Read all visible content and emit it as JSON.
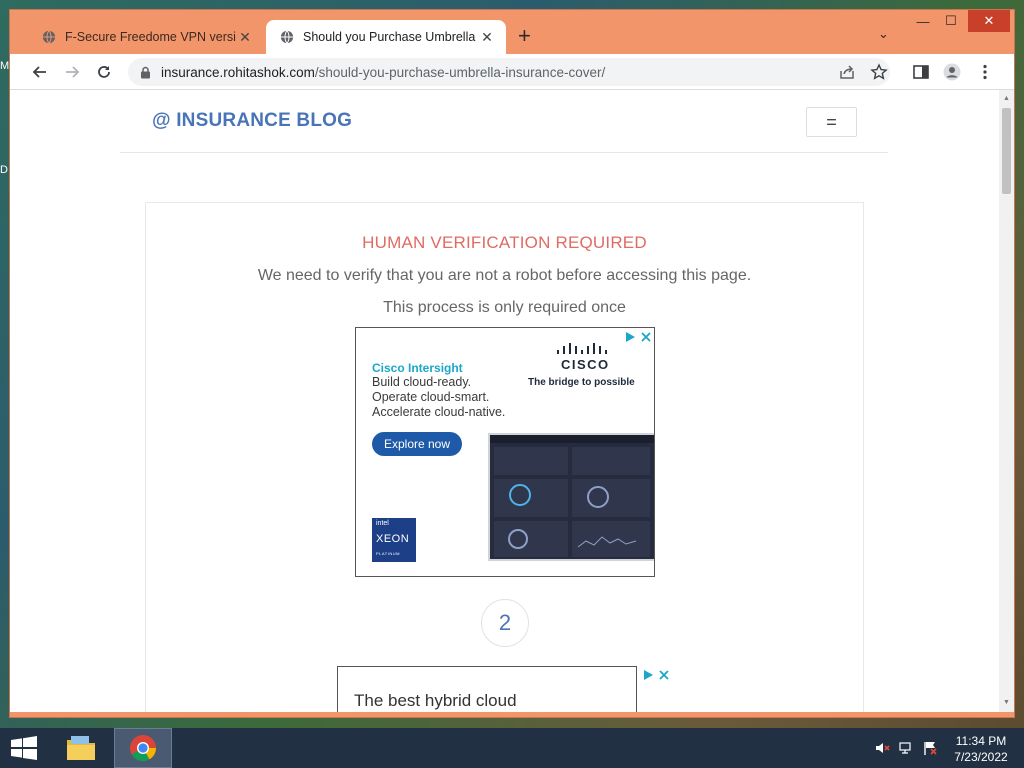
{
  "desktop": {
    "edge_chars": [
      "M",
      "D"
    ]
  },
  "browser": {
    "tabs": [
      {
        "label": "F-Secure Freedome VPN version",
        "active": false
      },
      {
        "label": "Should you Purchase Umbrella Insurance Cover",
        "active": true
      }
    ],
    "new_tab": "+",
    "tab_search": "⌄",
    "window_controls": {
      "minimize": "—",
      "maximize": "☐",
      "close": "✕"
    },
    "url": {
      "host": "insurance.rohitashok.com",
      "path": "/should-you-purchase-umbrella-insurance-cover/"
    }
  },
  "site": {
    "brand": "@ INSURANCE BLOG",
    "menu_icon": "="
  },
  "verification": {
    "title": "HUMAN VERIFICATION REQUIRED",
    "line1": "We need to verify that you are not a robot before accessing this page.",
    "line2": "This process is only required once",
    "step": "2"
  },
  "ad1": {
    "headline": "Cisco Intersight",
    "copy": [
      "Build cloud-ready.",
      "Operate cloud-smart.",
      "Accelerate cloud-native."
    ],
    "brand": "CISCO",
    "tagline": "The bridge to possible",
    "cta": "Explore now",
    "badge": {
      "maker": "intel",
      "name": "XEON",
      "tier": "PLATINUM"
    }
  },
  "ad2": {
    "text": "The best hybrid cloud"
  },
  "taskbar": {
    "time": "11:34 PM",
    "date": "7/23/2022"
  },
  "colors": {
    "window_frame": "#f2956a",
    "brand_blue": "#4a74b8",
    "alert_red": "#e06b63",
    "cta_blue": "#1e5aa8",
    "taskbar": "#223044"
  }
}
